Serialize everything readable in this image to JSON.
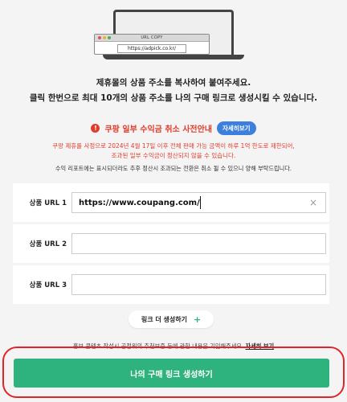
{
  "illustration": {
    "browser_title": "URL COPY",
    "browser_url": "https://adpick.co.kr/"
  },
  "headline": {
    "line1": "제휴몰의 상품 주소를 복사하여 붙여주세요.",
    "line2": "클릭 한번으로 최대 10개의 상품 주소를 나의 구매 링크로 생성시킬 수 있습니다."
  },
  "notice": {
    "title": "쿠팡 일부 수익금 취소 사전안내",
    "detail_button": "자세히보기",
    "red_line1": "쿠팡 제휴를 사정으로 2024년 4월 17일 이후 전체 판매 가능 금액이 하루 1억 한도로 제한되어,",
    "red_line2": "조과된 일부 수익금이 정산되지 않을 수 있습니다.",
    "gray_line": "수익 리포트에는 표시되더라도 추후 정산시 조과되는 전환은 취소 될 수 있으니 양해 부탁드립니다."
  },
  "form": {
    "rows": [
      {
        "label": "상품 URL 1",
        "value": "https://www.coupang.com/"
      },
      {
        "label": "상품 URL 2",
        "value": ""
      },
      {
        "label": "상품 URL 3",
        "value": ""
      }
    ],
    "clear_symbol": "×"
  },
  "add_more": {
    "label": "링크 더 생성하기",
    "icon": "+"
  },
  "footer_note": {
    "text": "홍보 콘텐츠 작성시 공정위의 추천보증 등에 관한 내용을 기입해주세요.",
    "link": "자세히 보기"
  },
  "generate_button": "나의 구매 링크 생성하기",
  "colors": {
    "accent_green": "#2fb37e",
    "warn_red": "#e23b2a",
    "highlight_red": "#e0242a",
    "detail_blue": "#3d7fdc"
  }
}
